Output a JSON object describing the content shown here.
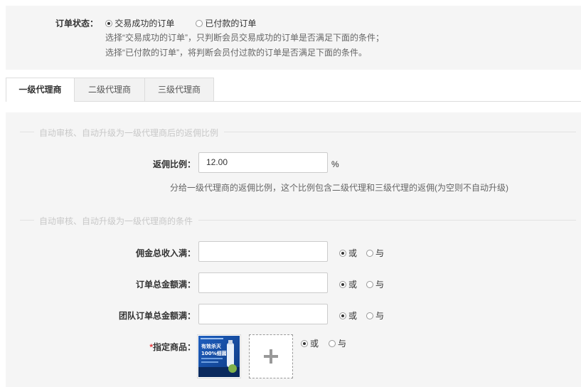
{
  "order_status": {
    "label": "订单状态：",
    "option_success": "交易成功的订单",
    "option_paid": "已付款的订单",
    "hint1": "选择“交易成功的订单”，只判断会员交易成功的订单是否满足下面的条件；",
    "hint2": "选择“已付款的订单”，将判断会员付过款的订单是否满足下面的条件。"
  },
  "tabs": [
    {
      "label": "一级代理商"
    },
    {
      "label": "二级代理商"
    },
    {
      "label": "三级代理商"
    }
  ],
  "rebate_section": {
    "title": "自动审核、自动升级为一级代理商后的返佣比例",
    "label": "返佣比例：",
    "value": "12.00",
    "unit": "%",
    "hint": "分给一级代理商的返佣比例，这个比例包含二级代理和三级代理的返佣(为空则不自动升级)"
  },
  "conditions_section": {
    "title": "自动审核、自动升级为一级代理商的条件",
    "fields": [
      {
        "label": "佣金总收入满：",
        "value": ""
      },
      {
        "label": "订单总金额满：",
        "value": ""
      },
      {
        "label": "团队订单总金额满：",
        "value": ""
      }
    ],
    "or_label": "或",
    "and_label": "与",
    "product": {
      "required_mark": "*",
      "label": "指定商品：",
      "thumb_text_1": "有效杀灭",
      "thumb_text_2": "100%细菌",
      "add_glyph": "+"
    }
  },
  "colors": {
    "panel_bg": "#f5f5f5",
    "required": "#e4393c",
    "thumb_blue": "#1a4fa0"
  }
}
